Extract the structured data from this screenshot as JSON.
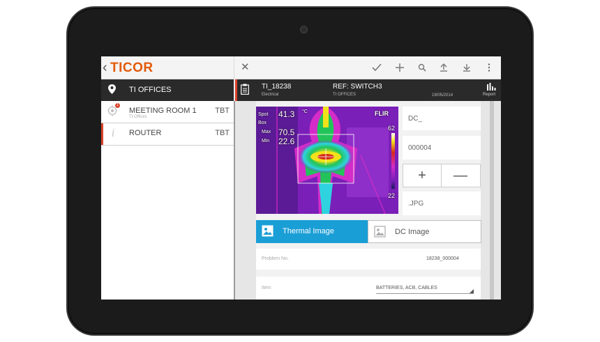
{
  "app": {
    "logo": "TICOR",
    "toolbar_icons": [
      "check-icon",
      "plus-icon",
      "search-icon",
      "upload-icon",
      "download-icon",
      "more-icon"
    ]
  },
  "left_panel": {
    "title": "TI OFFICES",
    "items": [
      {
        "label": "MEETING ROOM 1",
        "sub": "TI Offices",
        "status": "TBT",
        "badge": "1",
        "icon": "location-pin-icon",
        "selected": false
      },
      {
        "label": "ROUTER",
        "sub": "",
        "status": "TBT",
        "icon": "info-icon",
        "selected": true
      }
    ]
  },
  "record": {
    "code": "TI_18238",
    "code_sub": "Electrical",
    "ref": "REF: SWITCH3",
    "ref_sub": "TI OFFICES",
    "date": "19/05/2014",
    "report_label": "Report"
  },
  "thermal": {
    "spot_label": "Spot",
    "spot_value": "41.3",
    "unit": "°C",
    "box_label": "Box",
    "max_label": "Max",
    "max_value": "70.5",
    "min_label": "Min",
    "min_value": "22.6",
    "brand": "FLIR",
    "scale_max": "62",
    "scale_min": "22",
    "colors": {
      "purple": "#7a1fb8",
      "magenta": "#d42cc8",
      "yellow": "#f2e21a",
      "green": "#22c45a",
      "cyan": "#2fd3e0",
      "red": "#d62a1c"
    }
  },
  "fields": {
    "dc_name": "DC_",
    "counter": "000004",
    "extension": ".JPG",
    "plus_label": "+",
    "minus_label": "—"
  },
  "tabs": {
    "thermal_label": "Thermal Image",
    "dc_label": "DC Image",
    "active": "thermal"
  },
  "form": {
    "problem_label": "Problem No.",
    "problem_value": "18238_000004",
    "item_label": "Item",
    "item_value": "BATTERIES, ACB, CABLES"
  },
  "colors": {
    "accent": "#d9442b",
    "brand": "#e35a0a",
    "active_tab": "#1a9ed6",
    "header": "#2a2a2a"
  }
}
